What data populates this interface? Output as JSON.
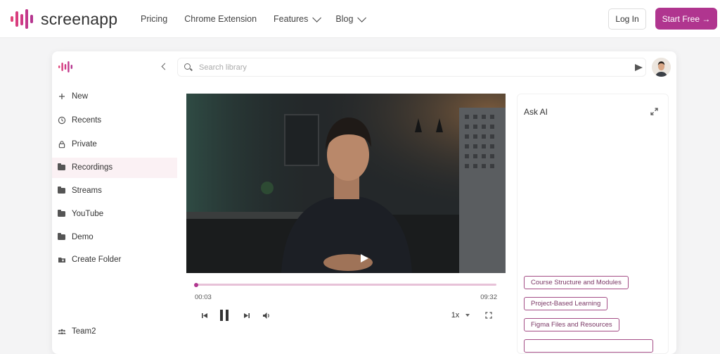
{
  "brand": {
    "name": "screenapp",
    "accent": "#b0358f"
  },
  "nav": {
    "links": [
      {
        "label": "Pricing"
      },
      {
        "label": "Chrome Extension"
      },
      {
        "label": "Features"
      },
      {
        "label": "Blog"
      }
    ],
    "login_label": "Log In",
    "start_label": "Start Free →"
  },
  "sidebar": {
    "items": [
      {
        "label": "New",
        "icon": "plus-icon"
      },
      {
        "label": "Recents",
        "icon": "clock-icon"
      },
      {
        "label": "Private",
        "icon": "lock-icon"
      },
      {
        "label": "Recordings",
        "icon": "folder-icon"
      },
      {
        "label": "Streams",
        "icon": "folder-icon"
      },
      {
        "label": "YouTube",
        "icon": "folder-icon"
      },
      {
        "label": "Demo",
        "icon": "folder-icon"
      },
      {
        "label": "Create Folder",
        "icon": "folder-plus-icon"
      }
    ],
    "active_item": "Recordings",
    "team_label": "Team2"
  },
  "search": {
    "placeholder": "Search library",
    "value": ""
  },
  "player": {
    "current_time": "00:03",
    "duration": "09:32",
    "progress": 0.005,
    "speed": "1x"
  },
  "ai": {
    "title": "Ask AI",
    "suggestions": [
      {
        "label": "Course Structure and Modules"
      },
      {
        "label": "Project-Based Learning"
      },
      {
        "label": "Figma Files and Resources"
      }
    ]
  }
}
